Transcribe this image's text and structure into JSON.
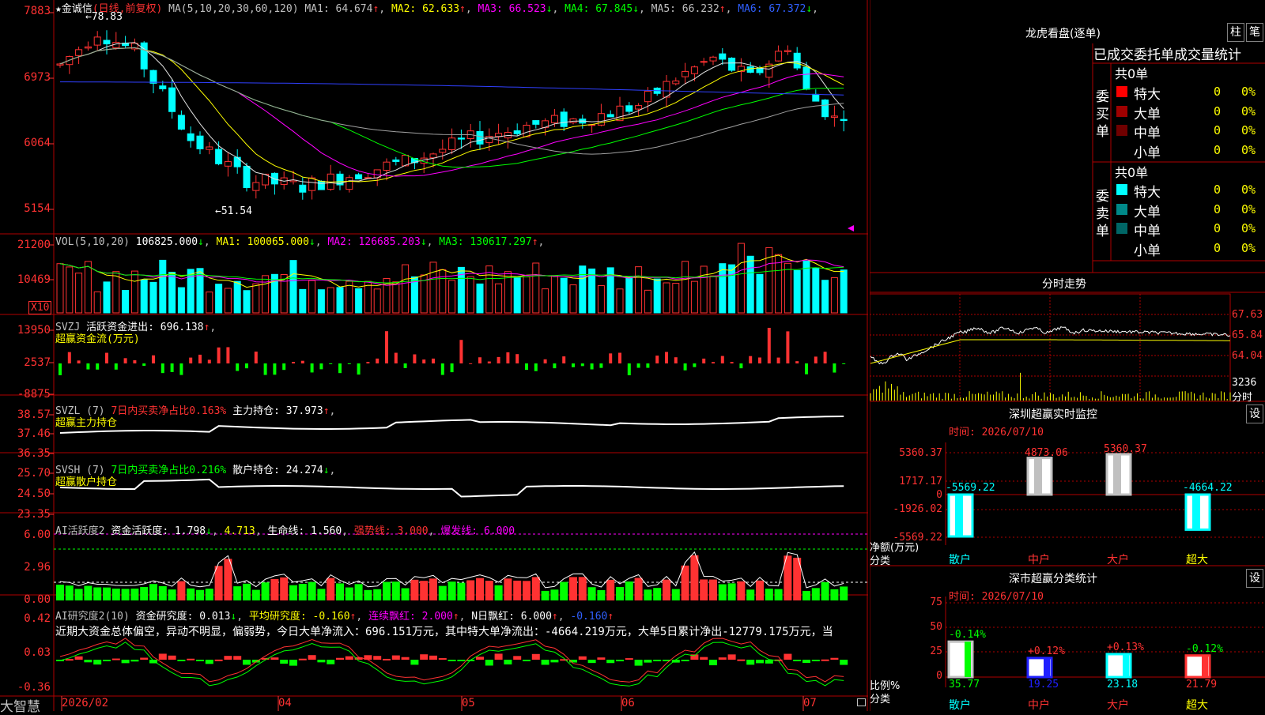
{
  "stock": {
    "star": "★",
    "name": "金诚信",
    "mode": "(日线,前复权)"
  },
  "ma": {
    "label": "MA(5,10,20,30,60,120)",
    "items": [
      {
        "text": "MA1: 64.674",
        "arrow": "↑",
        "color": "#c0c0c0"
      },
      {
        "text": "MA2: 62.633",
        "arrow": "↑",
        "color": "#ffff00"
      },
      {
        "text": "MA3: 66.523",
        "arrow": "↓",
        "color": "#ff00ff"
      },
      {
        "text": "MA4: 67.845",
        "arrow": "↓",
        "color": "#00ff00"
      },
      {
        "text": "MA5: 66.232",
        "arrow": "↑",
        "color": "#c0c0c0"
      },
      {
        "text": "MA6: 67.372",
        "arrow": "↓",
        "color": "#3060ff"
      }
    ]
  },
  "price_axis": [
    "7883",
    "6973",
    "6064",
    "5154"
  ],
  "price_annotations": {
    "high": "←78.83",
    "low": "←51.54"
  },
  "vol": {
    "label": "VOL(5,10,20)",
    "value": "106825.000",
    "value_arrow": "↓",
    "items": [
      {
        "text": "MA1: 100065.000",
        "arrow": "↓",
        "color": "#ffff00"
      },
      {
        "text": "MA2: 126685.203",
        "arrow": "↓",
        "color": "#ff00ff"
      },
      {
        "text": "MA3: 130617.297",
        "arrow": "↑",
        "color": "#00ff00"
      }
    ],
    "axis": [
      "21200",
      "10469"
    ],
    "unit": "X10"
  },
  "svzj": {
    "label": "SVZJ",
    "line": "活跃资金进出: 696.138",
    "arrow": "↑",
    "sub": "超赢资金流(万元)",
    "axis": [
      "13950",
      "2537",
      "-8875"
    ]
  },
  "svzl": {
    "label": "SVZL (7)",
    "pct": "7日内买卖净占比0.163%",
    "hold": "主力持仓: 37.973",
    "arrow": "↑",
    "sub": "超赢主力持仓",
    "axis": [
      "38.57",
      "37.46",
      "36.35"
    ]
  },
  "svsh": {
    "label": "SVSH (7)",
    "pct": "7日内买卖净占比0.216%",
    "hold": "散户持仓: 24.274",
    "arrow": "↓",
    "sub": "超赢散户持仓",
    "axis": [
      "25.70",
      "24.50",
      "23.35"
    ]
  },
  "ai1": {
    "label": "AI活跃度2",
    "active": "资金活跃度: 1.798",
    "a_arrow": "↓",
    "v2": "4.713",
    "life": "生命线: 1.560",
    "strong": "强势线: 3.000",
    "burst": "爆发线: 6.000",
    "axis": [
      "6.00",
      "2.96",
      "0.00"
    ]
  },
  "ai2": {
    "label": "AI研究度2(10)",
    "research": "资金研究度: 0.013",
    "r_arrow": "↓",
    "avg": "平均研究度: -0.160",
    "avg_arrow": "↑",
    "lianxu": "连续飘红: 2.000",
    "lx_arrow": "↑",
    "nday": "N日飘红: 6.000",
    "nd_arrow": "↑",
    "last": "-0.160",
    "last_arrow": "↑",
    "summary": "近期大资金总体偏空，异动不明显，偏弱势，今日大单净流入：696.151万元，其中特大单净流出：-4664.219万元，大单5日累计净出-12779.175万元，当",
    "axis": [
      "0.42",
      "0.03",
      "-0.36"
    ]
  },
  "timeaxis": {
    "brand": "大智慧",
    "labels": [
      "2026/02",
      "04",
      "05",
      "06",
      "07"
    ]
  },
  "longhu": {
    "title": "龙虎看盘(逐单)",
    "btn1": "柱",
    "btn2": "笔",
    "header": "已成交委托单成交量统计",
    "buy": {
      "side": "委买单",
      "total": "共0单",
      "rows": [
        {
          "label": "特大",
          "v": "0",
          "p": "0%",
          "color": "#ff0000"
        },
        {
          "label": "大单",
          "v": "0",
          "p": "0%",
          "color": "#a00000"
        },
        {
          "label": "中单",
          "v": "0",
          "p": "0%",
          "color": "#700000"
        },
        {
          "label": "小单",
          "v": "0",
          "p": "0%",
          "color": "#000000"
        }
      ]
    },
    "sell": {
      "side": "委卖单",
      "total": "共0单",
      "rows": [
        {
          "label": "特大",
          "v": "0",
          "p": "0%",
          "color": "#00ffff"
        },
        {
          "label": "大单",
          "v": "0",
          "p": "0%",
          "color": "#008888"
        },
        {
          "label": "中单",
          "v": "0",
          "p": "0%",
          "color": "#006666"
        },
        {
          "label": "小单",
          "v": "0",
          "p": "0%",
          "color": "#000000"
        }
      ]
    }
  },
  "fenshi": {
    "title": "分时走势",
    "axis": [
      "67.63",
      "65.84",
      "64.04",
      "3236"
    ],
    "unit": "分时"
  },
  "monitor": {
    "title": "深圳超赢实时监控",
    "btn": "设",
    "time": "时间: 2026/07/10",
    "axis": [
      "5360.37",
      "1717.17",
      "0",
      "-1926.02",
      "-5569.22"
    ],
    "bars": [
      {
        "cat": "散户",
        "value": "-5569.22",
        "num": -5569.22
      },
      {
        "cat": "中户",
        "value": "4873.06",
        "num": 4873.06
      },
      {
        "cat": "大户",
        "value": "5360.37",
        "num": 5360.37
      },
      {
        "cat": "超大",
        "value": "-4664.22",
        "num": -4664.22
      }
    ],
    "yname": "净额(万元)",
    "xname": "分类"
  },
  "classify": {
    "title": "深市超赢分类统计",
    "btn": "设",
    "time": "时间: 2026/07/10",
    "axis": [
      "75",
      "50",
      "25",
      "0"
    ],
    "bars": [
      {
        "cat": "散户",
        "pct": "-0.14%",
        "value": "35.77",
        "num": 35.77
      },
      {
        "cat": "中户",
        "pct": "+0.12%",
        "value": "19.25",
        "num": 19.25
      },
      {
        "cat": "大户",
        "pct": "+0.13%",
        "value": "23.18",
        "num": 23.18
      },
      {
        "cat": "超大",
        "pct": "-0.12%",
        "value": "21.79",
        "num": 21.79
      }
    ],
    "yname": "比例%",
    "xname": "分类"
  }
}
